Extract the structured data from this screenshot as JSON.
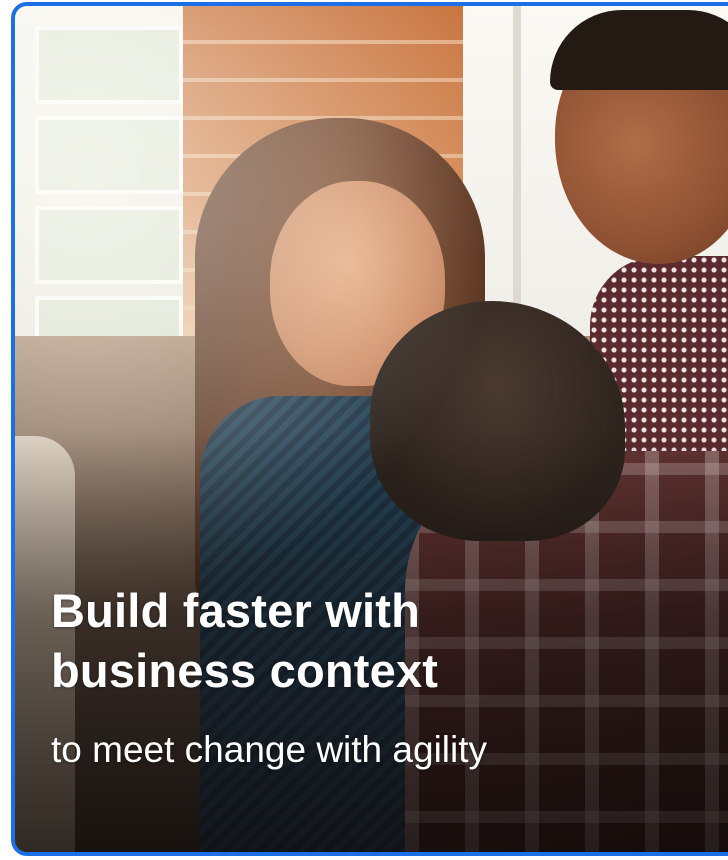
{
  "card": {
    "headline_line1": "Build faster with",
    "headline_line2": "business context",
    "subheadline": "to meet change with agility",
    "border_color": "#1d6fe8",
    "image": "photo of three colleagues collaborating near a bright window"
  }
}
